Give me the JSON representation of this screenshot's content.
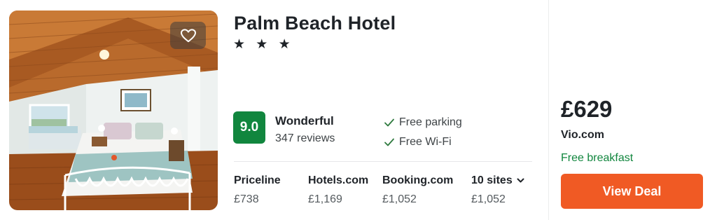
{
  "hotel": {
    "name": "Palm Beach Hotel",
    "stars_text": "★ ★ ★",
    "star_count": 3
  },
  "rating": {
    "score": "9.0",
    "label": "Wonderful",
    "reviews": "347 reviews"
  },
  "amenities": [
    "Free parking",
    "Free Wi-Fi"
  ],
  "prices": [
    {
      "site": "Priceline",
      "price": "£738"
    },
    {
      "site": "Hotels.com",
      "price": "£1,169"
    },
    {
      "site": "Booking.com",
      "price": "£1,052"
    },
    {
      "site": "10 sites",
      "price": "£1,052"
    }
  ],
  "deal": {
    "price": "£629",
    "provider": "Vio.com",
    "perk": "Free breakfast",
    "button_label": "View Deal"
  },
  "colors": {
    "score_bg": "#11863e",
    "perk": "#11863e",
    "button": "#f05a24"
  },
  "icons": [
    "heart-icon",
    "check-icon",
    "chevron-down-icon"
  ]
}
